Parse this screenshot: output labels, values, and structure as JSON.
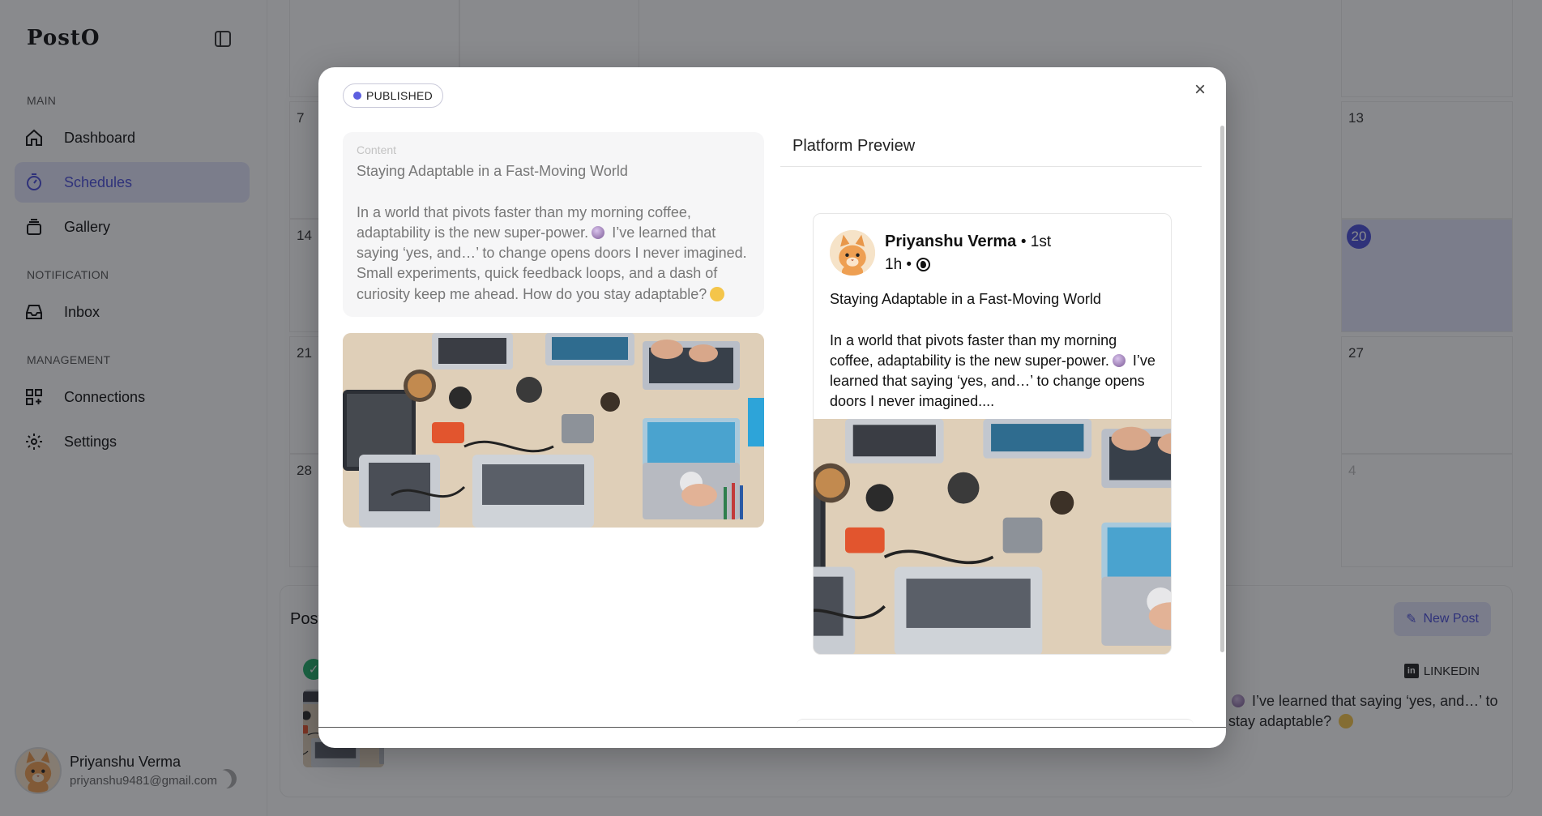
{
  "sidebar": {
    "logo": "PostO",
    "sections": {
      "main": "MAIN",
      "notification": "NOTIFICATION",
      "management": "MANAGEMENT"
    },
    "items": {
      "dashboard": "Dashboard",
      "schedules": "Schedules",
      "gallery": "Gallery",
      "inbox": "Inbox",
      "connections": "Connections",
      "settings": "Settings"
    },
    "user": {
      "name": "Priyanshu Verma",
      "email": "priyanshu9481@gmail.com"
    }
  },
  "calendar": {
    "row2": [
      "7",
      "13"
    ],
    "row3": [
      "14",
      "20"
    ],
    "row4": [
      "21",
      "27"
    ],
    "row5": [
      "28",
      "4"
    ]
  },
  "posts": {
    "title": "Post",
    "new_post_label": "New Post",
    "platform_tag": "LINKEDIN",
    "snippet_a": "I’ve learned that saying ‘yes, and…’ to",
    "snippet_b": "stay adaptable?"
  },
  "modal": {
    "status": "PUBLISHED",
    "close_glyph": "×",
    "content_label": "Content",
    "content_title": "Staying Adaptable in a Fast-Moving World",
    "content_body_a": "In a world that pivots faster than my morning coffee, adaptability is the new super-power.",
    "content_body_b": "I’ve learned that saying ‘yes, and…’ to change opens doors I never imagined. Small experiments, quick feedback loops, and a dash of curiosity keep me ahead. How do you stay adaptable?",
    "preview_title": "Platform Preview",
    "preview": {
      "name": "Priyanshu Verma",
      "degree": "• 1st",
      "time": "1h •",
      "title": "Staying Adaptable in a Fast-Moving World",
      "body_a": "In a world that pivots faster than my morning coffee, adaptability is the new super-power.",
      "body_b": "I’ve learned that saying ‘yes, and…’ to change opens doors I never imagined...."
    }
  },
  "colors": {
    "accent": "#4b4fd9",
    "accent_light": "#e3e4fb",
    "status_dot": "#5c5fe0"
  },
  "icons": {
    "dashboard": "home-icon",
    "schedules": "timer-icon",
    "gallery": "layers-icon",
    "inbox": "inbox-icon",
    "connections": "grid-plus-icon",
    "settings": "gear-icon"
  }
}
